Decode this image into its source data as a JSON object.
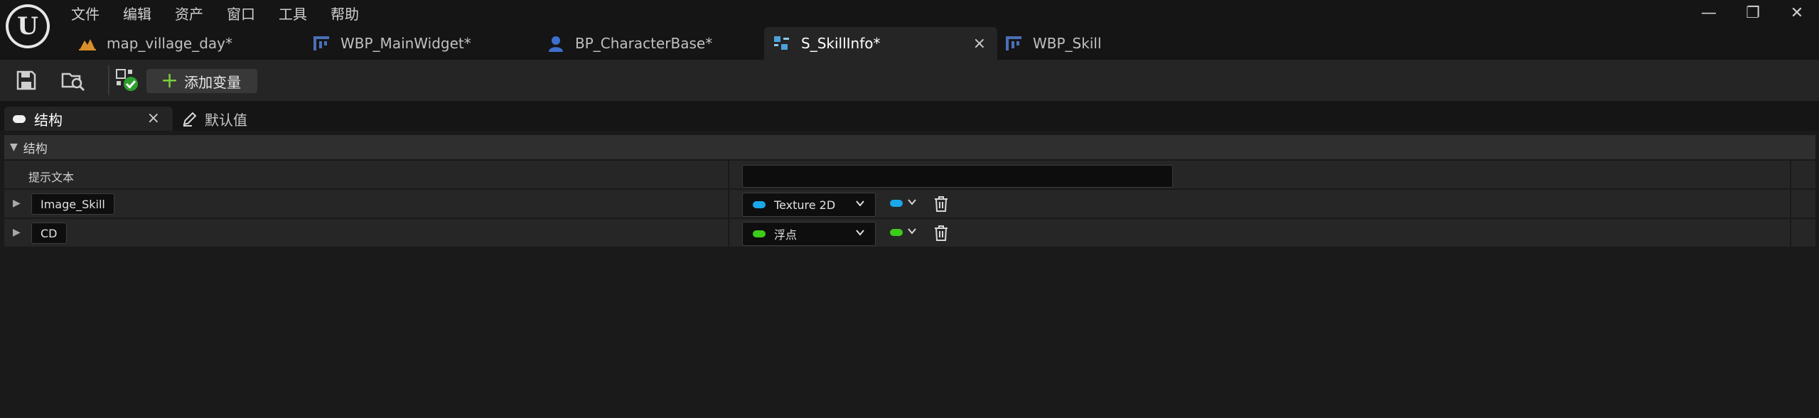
{
  "menu": [
    "文件",
    "编辑",
    "资产",
    "窗口",
    "工具",
    "帮助"
  ],
  "window_controls": {
    "minimize": "—",
    "restore": "❐",
    "close": "✕"
  },
  "tabs": [
    {
      "label": "map_village_day*",
      "icon": "level-icon",
      "color": "#d9902a"
    },
    {
      "label": "WBP_MainWidget*",
      "icon": "widget-blueprint-icon",
      "color": "#4a6fb8"
    },
    {
      "label": "BP_CharacterBase*",
      "icon": "character-blueprint-icon",
      "color": "#3e6fd0"
    },
    {
      "label": "S_SkillInfo*",
      "icon": "struct-icon",
      "color": "#4aa3d8",
      "active": true,
      "close": "×"
    },
    {
      "label": "WBP_Skill",
      "icon": "widget-blueprint-icon",
      "color": "#4a6fb8"
    }
  ],
  "toolbar": {
    "add_variable_label": "添加变量",
    "add_variable_icon": "+"
  },
  "panel_tabs": {
    "structure": {
      "label": "结构",
      "close": "×"
    },
    "defaults": {
      "label": "默认值"
    }
  },
  "section": {
    "title": "结构",
    "tooltip_label": "提示文本",
    "tooltip_value": ""
  },
  "fields": [
    {
      "name": "Image_Skill",
      "type": "Texture 2D",
      "color": "#1aa7ec"
    },
    {
      "name": "CD",
      "type": "浮点",
      "color": "#3ccc1a"
    }
  ],
  "colors": {
    "background": "#151515",
    "panel": "#262626",
    "accent_green": "#7ccf3a"
  }
}
